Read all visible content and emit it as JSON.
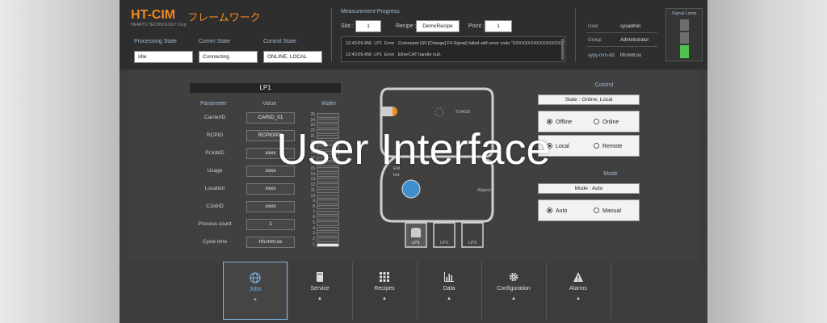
{
  "brand": {
    "title": "HT-CIM",
    "subtitle_jp": "フレームワーク",
    "company": "HEARTS TECHNOLOGY Corp."
  },
  "states": {
    "processing_label": "Processing State",
    "processing_value": "Idle",
    "comm_label": "Comm State",
    "comm_value": "Connecting",
    "control_label": "Control State",
    "control_value": "ONLINE, LOCAL"
  },
  "measurement": {
    "title": "Measurement Progress",
    "slot_label": "Slot :",
    "slot_value": "1",
    "recipe_label": "Recipe :",
    "recipe_value": "DemoRecipe",
    "point_label": "Point :",
    "point_value": "1"
  },
  "log": [
    {
      "time": "12:43:09.456",
      "port": "LP1",
      "level": "Error",
      "msg": "Command (S5 [Change] F4 Signal) failed with error code \"XXXXXXXXXXXXXXXXX\""
    },
    {
      "time": "12:43:09.456",
      "port": "LP1",
      "level": "Error",
      "msg": "EtherCAT handle null."
    }
  ],
  "user": {
    "user_label": "User",
    "user_value": "sysadmin",
    "group_label": "Group",
    "group_value": "Administrator",
    "date_label": "yyyy-mm-dd",
    "date_value": "hh:mm:ss"
  },
  "signal": {
    "title": "Signal Lamp",
    "colors": [
      "#6e6e6e",
      "#6e6e6e",
      "#4fc34f"
    ]
  },
  "lp": {
    "title": "LP1",
    "col_param": "Parameter",
    "col_value": "Value",
    "col_wafer": "Wafer",
    "rows": [
      {
        "name": "CarrierID",
        "value": "CARID_01"
      },
      {
        "name": "RCPID",
        "value": "RCPID001"
      },
      {
        "name": "PrJobID",
        "value": "xxxx"
      },
      {
        "name": "Usage",
        "value": "xxxx"
      },
      {
        "name": "Location",
        "value": "xxxx"
      },
      {
        "name": "CJobID",
        "value": "xxxx"
      },
      {
        "name": "Process count",
        "value": "1"
      },
      {
        "name": "Cycle time",
        "value": "hh:mm:ss"
      }
    ],
    "slots": [
      "25",
      "24",
      "23",
      "22",
      "21",
      "20",
      "19",
      "18",
      "17",
      "16",
      "15",
      "14",
      "13",
      "12",
      "11",
      "10",
      "9",
      "8",
      "7",
      "6",
      "5",
      "4",
      "3",
      "2",
      "1"
    ]
  },
  "diagram": {
    "stage": "STAGE",
    "em_label": "EM",
    "robot": "bot",
    "aligner": "Aligner",
    "ports": [
      "LP1",
      "LP2",
      "LP3"
    ]
  },
  "control": {
    "title": "Control",
    "state": "State : Online, Local",
    "offline": "Offline",
    "online": "Online",
    "local": "Local",
    "remote": "Remote",
    "mode_title": "Mode",
    "mode_state": "Mode : Auto",
    "auto": "Auto",
    "manual": "Manual"
  },
  "nav": [
    {
      "label": "Jobs",
      "icon": "globe-icon"
    },
    {
      "label": "Service",
      "icon": "book-icon"
    },
    {
      "label": "Recipes",
      "icon": "grid-icon"
    },
    {
      "label": "Data",
      "icon": "bar-chart-icon"
    },
    {
      "label": "Configuration",
      "icon": "gear-icon"
    },
    {
      "label": "Alarms",
      "icon": "warning-icon"
    }
  ],
  "overlay_text": "User Interface"
}
